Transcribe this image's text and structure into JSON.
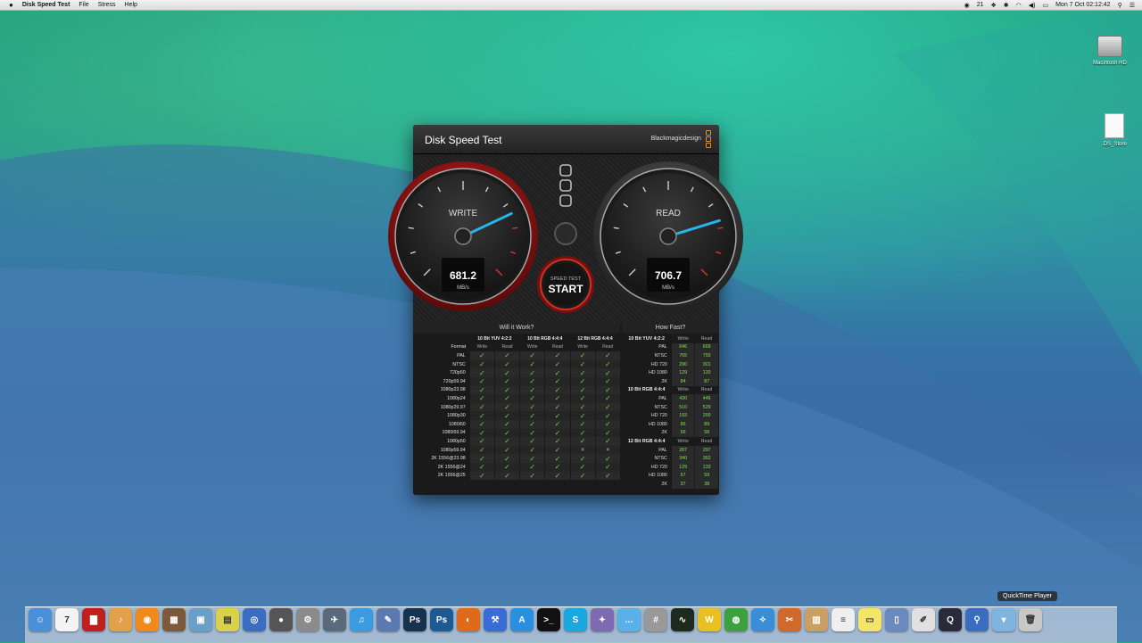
{
  "menubar": {
    "app_name": "Disk Speed Test",
    "items": [
      "File",
      "Stress",
      "Help"
    ],
    "status_num": "21",
    "datetime": "Mon 7 Oct  02:12:42"
  },
  "desktop": {
    "icons": [
      "Macintosh HD",
      ".DS_Store"
    ]
  },
  "window": {
    "title": "Disk Speed Test",
    "brand": "Blackmagicdesign",
    "write": {
      "label": "WRITE",
      "value": "681.2",
      "unit": "MB/s",
      "level": 0.74
    },
    "read": {
      "label": "READ",
      "value": "706.7",
      "unit": "MB/s",
      "level": 0.77
    },
    "start": {
      "small": "SPEED TEST",
      "big": "START"
    }
  },
  "will_it_work": {
    "title": "Will it Work?",
    "groups": [
      "10 Bit YUV 4:2:2",
      "10 Bit RGB 4:4:4",
      "12 Bit RGB 4:4:4"
    ],
    "format_label": "Format",
    "sub": [
      "Write",
      "Read"
    ],
    "rows": [
      {
        "f": "PAL",
        "c": [
          1,
          1,
          1,
          1,
          1,
          1
        ]
      },
      {
        "f": "NTSC",
        "c": [
          1,
          1,
          1,
          1,
          1,
          1
        ]
      },
      {
        "f": "720p50",
        "c": [
          1,
          1,
          1,
          1,
          1,
          1
        ]
      },
      {
        "f": "720p59.94",
        "c": [
          1,
          1,
          1,
          1,
          1,
          1
        ]
      },
      {
        "f": "1080p23.98",
        "c": [
          1,
          1,
          1,
          1,
          1,
          1
        ]
      },
      {
        "f": "1080p24",
        "c": [
          1,
          1,
          1,
          1,
          1,
          1
        ]
      },
      {
        "f": "1080p29.97",
        "c": [
          1,
          1,
          1,
          1,
          1,
          1
        ]
      },
      {
        "f": "1080p30",
        "c": [
          1,
          1,
          1,
          1,
          1,
          1
        ]
      },
      {
        "f": "1080i50",
        "c": [
          1,
          1,
          1,
          1,
          1,
          1
        ]
      },
      {
        "f": "1080i59.94",
        "c": [
          1,
          1,
          1,
          1,
          1,
          1
        ]
      },
      {
        "f": "1080p50",
        "c": [
          1,
          1,
          1,
          1,
          1,
          1
        ]
      },
      {
        "f": "1080p59.94",
        "c": [
          1,
          1,
          1,
          1,
          0,
          0
        ]
      },
      {
        "f": "2K 1556@23.98",
        "c": [
          1,
          1,
          1,
          1,
          1,
          1
        ]
      },
      {
        "f": "2K 1556@24",
        "c": [
          1,
          1,
          1,
          1,
          1,
          1
        ]
      },
      {
        "f": "2K 1556@25",
        "c": [
          1,
          1,
          1,
          1,
          1,
          1
        ]
      }
    ]
  },
  "how_fast": {
    "title": "How Fast?",
    "sub": [
      "Write",
      "Read"
    ],
    "groups": [
      {
        "name": "10 Bit YUV 4:2:2",
        "rows": [
          [
            "PAL",
            "646",
            "669"
          ],
          [
            "NTSC",
            "765",
            "793"
          ],
          [
            "HD 720",
            "290",
            "301"
          ],
          [
            "HD 1080",
            "129",
            "133"
          ],
          [
            "2K",
            "84",
            "87"
          ]
        ]
      },
      {
        "name": "10 Bit RGB 4:4:4",
        "rows": [
          [
            "PAL",
            "430",
            "446"
          ],
          [
            "NTSC",
            "510",
            "529"
          ],
          [
            "HD 720",
            "193",
            "200"
          ],
          [
            "HD 1080",
            "86",
            "89"
          ],
          [
            "2K",
            "56",
            "58"
          ]
        ]
      },
      {
        "name": "12 Bit RGB 4:4:4",
        "rows": [
          [
            "PAL",
            "287",
            "297"
          ],
          [
            "NTSC",
            "340",
            "352"
          ],
          [
            "HD 720",
            "129",
            "133"
          ],
          [
            "HD 1080",
            "57",
            "59"
          ],
          [
            "2K",
            "37",
            "38"
          ]
        ]
      }
    ]
  },
  "dock": {
    "tooltip": "QuickTime Player",
    "apps": [
      {
        "n": "finder",
        "c": "#4a8fd8",
        "g": "☺"
      },
      {
        "n": "calendar",
        "c": "#f4f4f4",
        "g": "7"
      },
      {
        "n": "photo-booth",
        "c": "#c0201d",
        "g": "▇"
      },
      {
        "n": "garageband",
        "c": "#e1a14a",
        "g": "♪"
      },
      {
        "n": "ibooks",
        "c": "#f08a1a",
        "g": "◉"
      },
      {
        "n": "iphoto",
        "c": "#7a5a3a",
        "g": "▦"
      },
      {
        "n": "preview",
        "c": "#6aa0c8",
        "g": "▣"
      },
      {
        "n": "image-capture",
        "c": "#d9d14a",
        "g": "▤"
      },
      {
        "n": "network-utility",
        "c": "#3a6cc2",
        "g": "◎"
      },
      {
        "n": "dvd-player",
        "c": "#555",
        "g": "●"
      },
      {
        "n": "system-preferences",
        "c": "#8b8b8b",
        "g": "⚙"
      },
      {
        "n": "launchpad",
        "c": "#5b6a7a",
        "g": "✈"
      },
      {
        "n": "itunes",
        "c": "#3a9ce0",
        "g": "♫"
      },
      {
        "n": "automator",
        "c": "#5c7ab0",
        "g": "✎"
      },
      {
        "n": "photoshop",
        "c": "#17324f",
        "g": "Ps"
      },
      {
        "n": "photoshop-cc",
        "c": "#1d5a92",
        "g": "Ps"
      },
      {
        "n": "firefox",
        "c": "#e06a1a",
        "g": "◐"
      },
      {
        "n": "xcode",
        "c": "#3a6cd6",
        "g": "⚒"
      },
      {
        "n": "app-store",
        "c": "#2a8fe0",
        "g": "A"
      },
      {
        "n": "terminal",
        "c": "#111",
        "g": ">_"
      },
      {
        "n": "skype",
        "c": "#1aa8e0",
        "g": "S"
      },
      {
        "n": "utility",
        "c": "#7d6ab0",
        "g": "✦"
      },
      {
        "n": "messages",
        "c": "#5ab0e8",
        "g": "…"
      },
      {
        "n": "calculator",
        "c": "#999",
        "g": "#"
      },
      {
        "n": "activity-monitor",
        "c": "#1f2a1f",
        "g": "∿"
      },
      {
        "n": "word",
        "c": "#e8c020",
        "g": "W"
      },
      {
        "n": "chrome",
        "c": "#3aa040",
        "g": "◍"
      },
      {
        "n": "safari",
        "c": "#3a8ed8",
        "g": "✧"
      },
      {
        "n": "snippets",
        "c": "#d06a2a",
        "g": "✂"
      },
      {
        "n": "archive",
        "c": "#caa062",
        "g": "▥"
      },
      {
        "n": "textedit",
        "c": "#efefef",
        "g": "≡"
      },
      {
        "n": "stickies",
        "c": "#f4e46a",
        "g": "▭"
      },
      {
        "n": "pages",
        "c": "#6a8abf",
        "g": "▯"
      },
      {
        "n": "script-editor",
        "c": "#e0e0e0",
        "g": "✐"
      },
      {
        "n": "quicktime-player",
        "c": "#2a2a3a",
        "g": "Q"
      },
      {
        "n": "spotlight",
        "c": "#3a6cbf",
        "g": "⚲"
      },
      {
        "n": "downloads-folder",
        "c": "#7db4e0",
        "g": "▾"
      },
      {
        "n": "trash",
        "c": "#c8c8c8",
        "g": "🗑"
      }
    ]
  }
}
